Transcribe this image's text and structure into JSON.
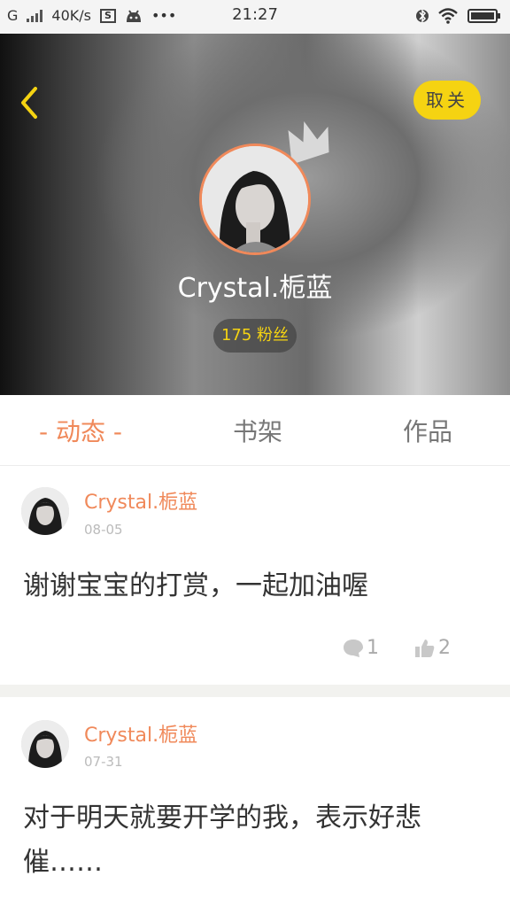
{
  "status_bar": {
    "carrier": "G",
    "speed": "40K/s",
    "sim_badge": "S",
    "more": "•••",
    "time": "21:27"
  },
  "profile": {
    "unfollow_label": "取关",
    "name": "Crystal.栀蓝",
    "fans": "175 粉丝"
  },
  "tabs": [
    {
      "label": "- 动态 -",
      "active": true
    },
    {
      "label": "书架",
      "active": false
    },
    {
      "label": "作品",
      "active": false
    }
  ],
  "posts": [
    {
      "author": "Crystal.栀蓝",
      "date": "08-05",
      "text": "谢谢宝宝的打赏，一起加油喔",
      "comments": "1",
      "likes": "2"
    },
    {
      "author": "Crystal.栀蓝",
      "date": "07-31",
      "text": "对于明天就要开学的我，表示好悲催……"
    }
  ],
  "colors": {
    "accent": "#f0895a",
    "follow_button": "#f5d312",
    "fans_text": "#f5d312"
  }
}
